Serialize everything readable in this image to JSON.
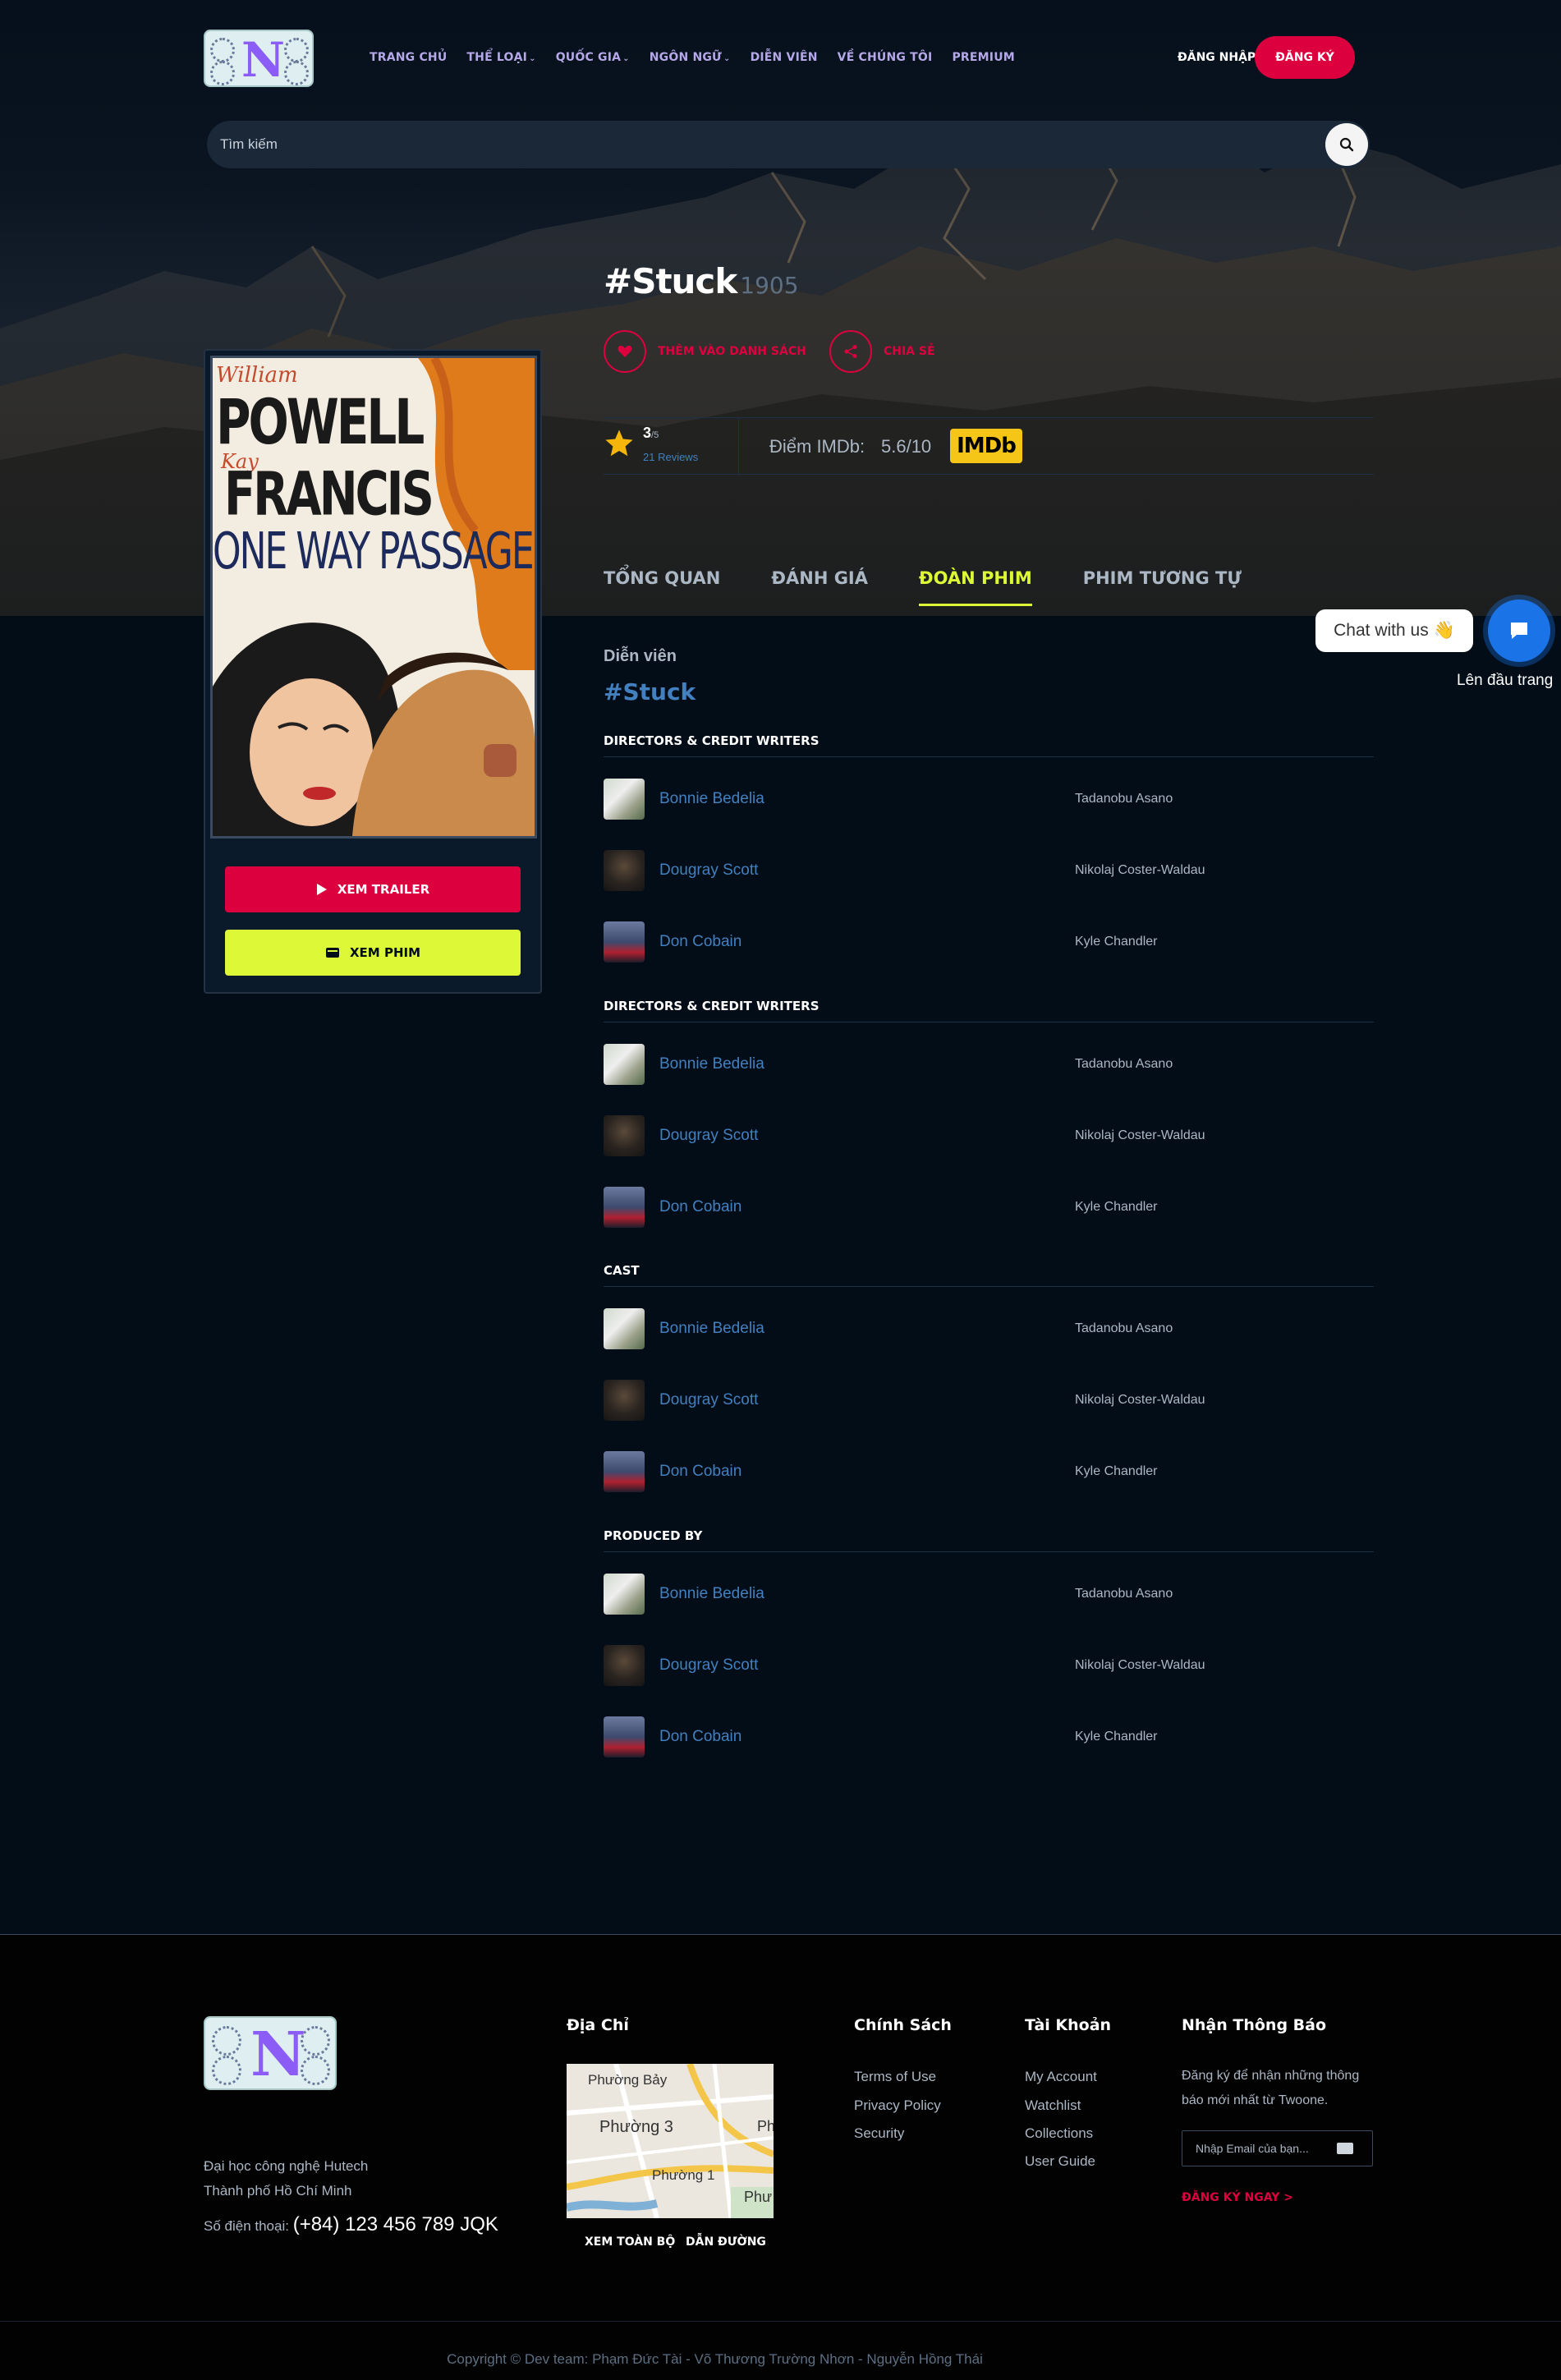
{
  "header": {
    "nav": [
      {
        "label": "TRANG CHỦ",
        "dropdown": false
      },
      {
        "label": "THỂ LOẠI",
        "dropdown": true
      },
      {
        "label": "QUỐC GIA",
        "dropdown": true
      },
      {
        "label": "NGÔN NGỮ",
        "dropdown": true
      },
      {
        "label": "DIỄN VIÊN",
        "dropdown": false
      },
      {
        "label": "VỀ CHÚNG TÔI",
        "dropdown": false
      },
      {
        "label": "PREMIUM",
        "dropdown": false
      }
    ],
    "login": "ĐĂNG NHẬP",
    "signup": "ĐĂNG KÝ"
  },
  "search": {
    "placeholder": "Tìm kiếm"
  },
  "movie": {
    "title": "#Stuck",
    "year": "1905",
    "add_to_list": "THÊM VÀO DANH SÁCH",
    "share": "CHIA SẺ",
    "rating": "3",
    "rating_max": "/5",
    "reviews": "21 Reviews",
    "imdb_label": "Điểm IMDb:",
    "imdb_score": "5.6/10",
    "imdb_badge": "IMDb",
    "trailer_button": "XEM TRAILER",
    "watch_button": "XEM PHIM"
  },
  "tabs": [
    {
      "label": "TỔNG QUAN",
      "active": false
    },
    {
      "label": "ĐÁNH GIÁ",
      "active": false
    },
    {
      "label": "ĐOÀN PHIM",
      "active": true
    },
    {
      "label": "PHIM TƯƠNG TỰ",
      "active": false
    }
  ],
  "cast": {
    "heading": "Diễn viên",
    "title": "#Stuck",
    "sections": [
      {
        "heading": "DIRECTORS & CREDIT WRITERS",
        "rows": [
          {
            "name": "Bonnie Bedelia",
            "role": "Tadanobu Asano",
            "avatar": "light"
          },
          {
            "name": "Dougray Scott",
            "role": "Nikolaj Coster-Waldau",
            "avatar": "dark"
          },
          {
            "name": "Don Cobain",
            "role": "Kyle Chandler",
            "avatar": "blue"
          }
        ]
      },
      {
        "heading": "DIRECTORS & CREDIT WRITERS",
        "rows": [
          {
            "name": "Bonnie Bedelia",
            "role": "Tadanobu Asano",
            "avatar": "light"
          },
          {
            "name": "Dougray Scott",
            "role": "Nikolaj Coster-Waldau",
            "avatar": "dark"
          },
          {
            "name": "Don Cobain",
            "role": "Kyle Chandler",
            "avatar": "blue"
          }
        ]
      },
      {
        "heading": "CAST",
        "rows": [
          {
            "name": "Bonnie Bedelia",
            "role": "Tadanobu Asano",
            "avatar": "light"
          },
          {
            "name": "Dougray Scott",
            "role": "Nikolaj Coster-Waldau",
            "avatar": "dark"
          },
          {
            "name": "Don Cobain",
            "role": "Kyle Chandler",
            "avatar": "blue"
          }
        ]
      },
      {
        "heading": "PRODUCED BY",
        "rows": [
          {
            "name": "Bonnie Bedelia",
            "role": "Tadanobu Asano",
            "avatar": "light"
          },
          {
            "name": "Dougray Scott",
            "role": "Nikolaj Coster-Waldau",
            "avatar": "dark"
          },
          {
            "name": "Don Cobain",
            "role": "Kyle Chandler",
            "avatar": "blue"
          }
        ]
      }
    ]
  },
  "poster": {
    "line1": "William",
    "line2": "POWELL",
    "line3": "Kay",
    "line4": "FRANCIS",
    "line5": "ONE WAY PASSAGE"
  },
  "chat": {
    "bubble": "Chat with us",
    "emoji": "👋",
    "back_to_top": "Lên đầu trang"
  },
  "footer": {
    "address_line1": "Đại học công nghệ Hutech",
    "address_line2": "Thành phố Hồ Chí Minh",
    "phone_label": "Số điện thoại:",
    "phone": "(+84) 123 456 789 JQK",
    "address_title": "Địa Chỉ",
    "map_labels": [
      "Phường Bảy",
      "Phường 3",
      "Phường 1",
      "Ph",
      "Phư"
    ],
    "map_view_all": "XEM TOÀN BỘ",
    "map_directions": "DẪN ĐƯỜNG",
    "policy_title": "Chính Sách",
    "policy_links": [
      "Terms of Use",
      "Privacy Policy",
      "Security"
    ],
    "account_title": "Tài Khoản",
    "account_links": [
      "My Account",
      "Watchlist",
      "Collections",
      "User Guide"
    ],
    "news_title": "Nhận Thông Báo",
    "news_text": "Đăng ký để nhận những thông báo mới nhất từ Twoone.",
    "email_placeholder": "Nhập Email của bạn...",
    "subscribe": "ĐĂNG KÝ NGAY >",
    "copyright": "Copyright © Dev team: Phạm Đức Tài - Võ Thương Trường Nhơn - Nguyễn Hồng Thái"
  },
  "colors": {
    "accent": "#dd003f",
    "highlight": "#dcf836",
    "link": "#4280bf",
    "imdb": "#f5c518"
  }
}
